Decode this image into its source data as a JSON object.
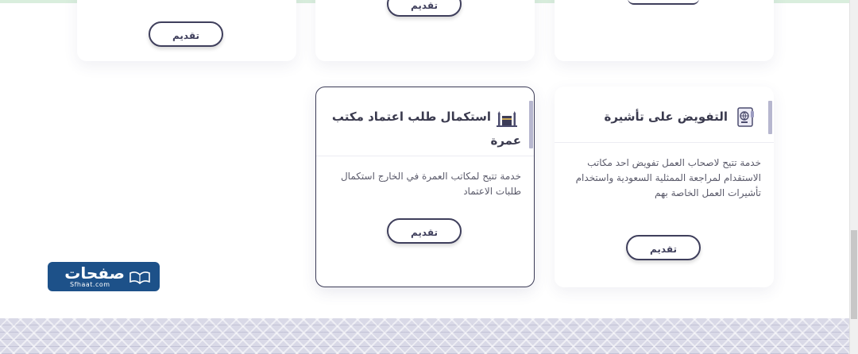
{
  "cards_top": [
    {
      "button": "تقديم"
    },
    {
      "button": "تقديم"
    },
    {
      "button": ""
    }
  ],
  "cards": [
    {
      "title": "التفويض على تأشيرة",
      "description": "خدمة تتيح لاصحاب العمل تفويض احد مكاتب الاستقدام لمراجعة الممثلية السعودية واستخدام تأشيرات العمل الخاصة بهم",
      "button": "تقديم",
      "icon": "passport-icon"
    },
    {
      "title_line1": "استكمال طلب اعتماد مكتب",
      "title_line2": "عمرة",
      "description": "خدمة تتيح لمكاتب العمرة في الخارج استكمال طلبات الاعتماد",
      "button": "تقديم",
      "icon": "kaaba-icon"
    }
  ],
  "logo": {
    "brand": "صفحات",
    "domain": "Sfhaat.com"
  },
  "colors": {
    "accent": "#3f3f5c",
    "logo_bg": "#1d5189",
    "bar": "#b7b7cf"
  }
}
